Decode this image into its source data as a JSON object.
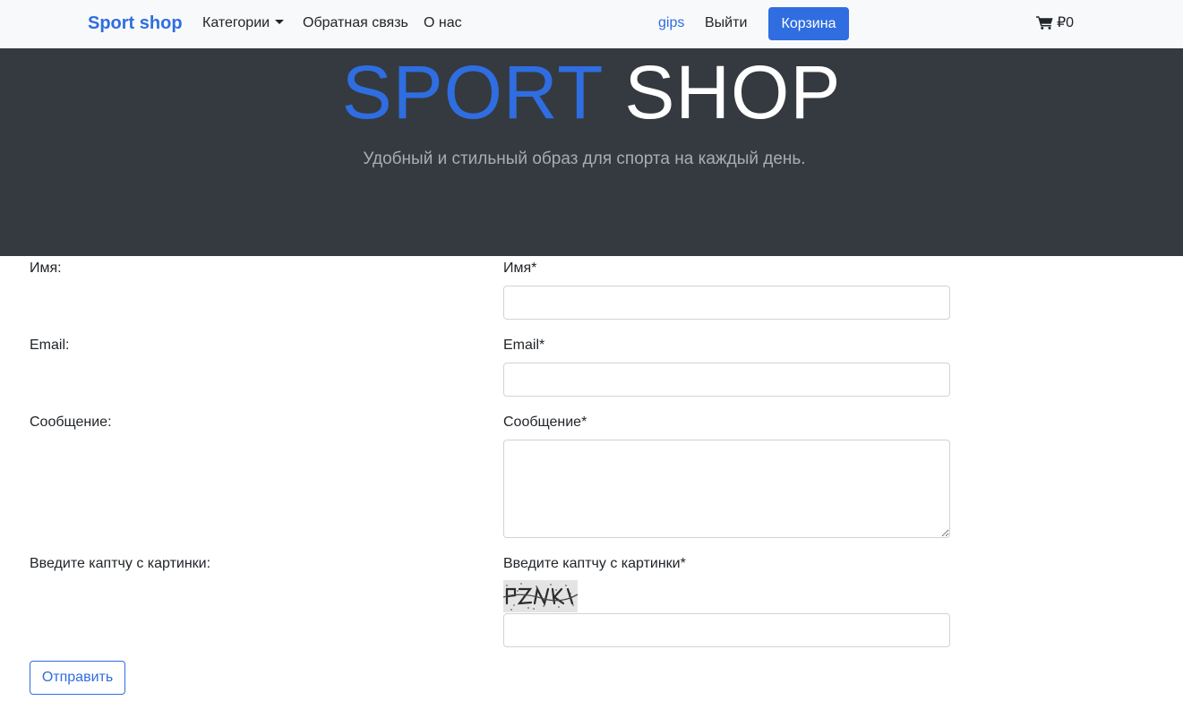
{
  "navbar": {
    "brand": "Sport shop",
    "categories": "Категории",
    "feedback": "Обратная связь",
    "about": "О нас",
    "user": "gips",
    "logout": "Выйти",
    "cart_button": "Корзина",
    "cart_total": "₽0",
    "cart_icon": "shopping-cart-icon"
  },
  "hero": {
    "title_part1": "SPORT",
    "title_part2": "SHOP",
    "subtitle": "Удобный и стильный образ для спорта на каждый день."
  },
  "form": {
    "name": {
      "row_label": "Имя:",
      "field_label": "Имя*",
      "value": ""
    },
    "email": {
      "row_label": "Email:",
      "field_label": "Email*",
      "value": ""
    },
    "message": {
      "row_label": "Сообщение:",
      "field_label": "Сообщение*",
      "value": ""
    },
    "captcha": {
      "row_label": "Введите каптчу с картинки:",
      "field_label": "Введите каптчу с картинки*",
      "value": ""
    },
    "submit": "Отправить"
  },
  "colors": {
    "accent": "#2f6de1",
    "hero_bg": "#343a40",
    "navbar_bg": "#f8f9fa"
  }
}
